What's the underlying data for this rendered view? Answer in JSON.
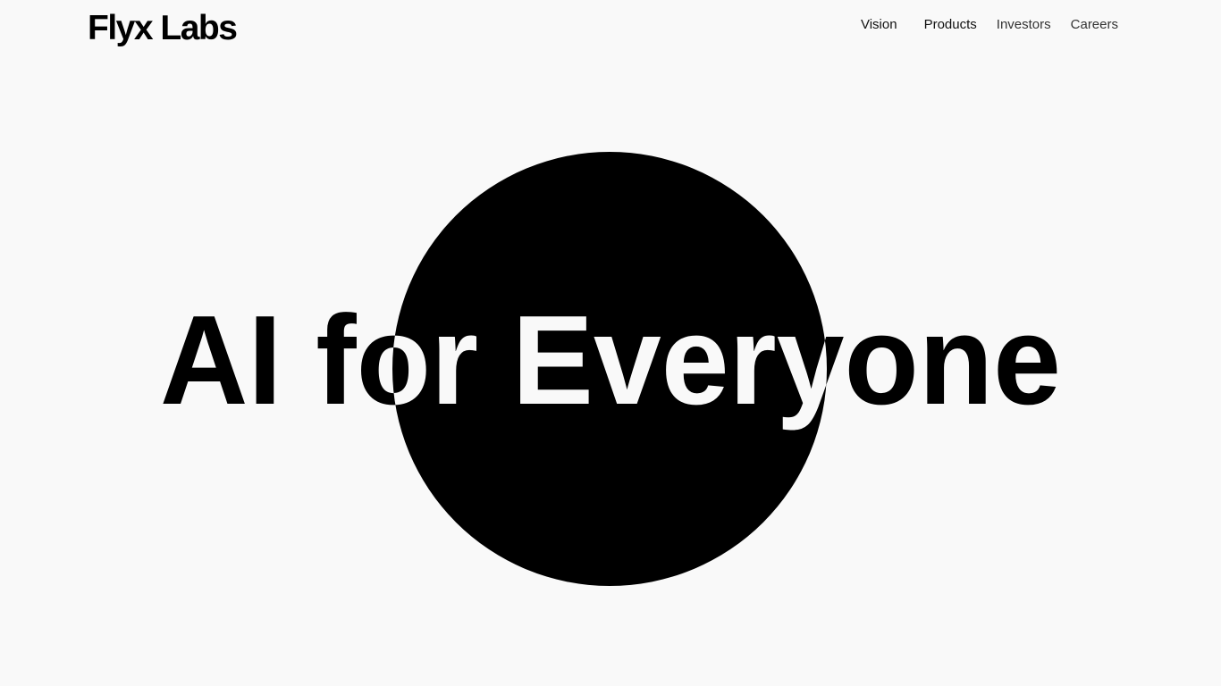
{
  "brand": {
    "name": "Flyx Labs"
  },
  "nav": {
    "items": [
      {
        "label": "Vision"
      },
      {
        "label": "Products"
      },
      {
        "label": "Investors"
      },
      {
        "label": "Careers"
      }
    ]
  },
  "hero": {
    "headline": "AI for Everyone"
  },
  "colors": {
    "background": "#f9f9f9",
    "foreground": "#000000"
  }
}
